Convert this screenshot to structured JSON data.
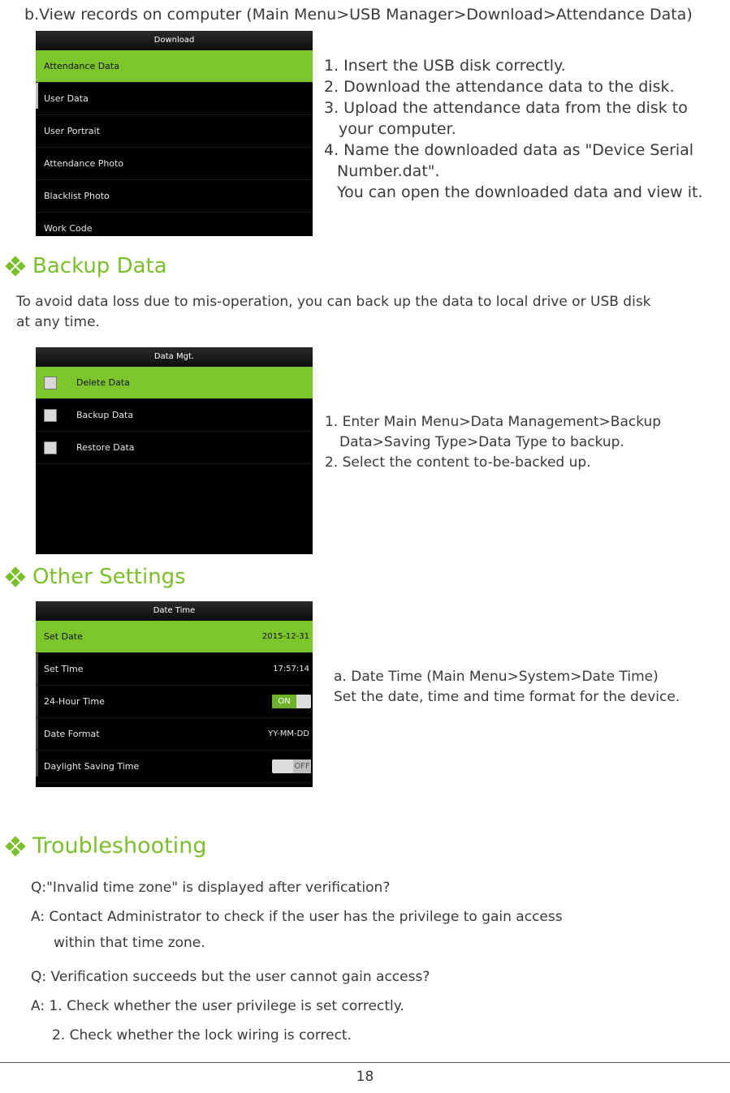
{
  "intro": "b.View records on computer (Main Menu>USB Manager>Download>Attendance Data)",
  "download_screen": {
    "title": "Download",
    "items": [
      "Attendance Data",
      "User Data",
      "User Portrait",
      "Attendance Photo",
      "Blacklist Photo",
      "Work Code"
    ]
  },
  "download_steps": [
    "1. Insert the USB disk correctly.",
    "2. Download the attendance data to the disk.",
    "3. Upload the attendance data from the disk to",
    "your computer.",
    "4. Name the downloaded data as \"Device Serial",
    "Number.dat\".",
    "You can open the downloaded data and view it."
  ],
  "backup": {
    "heading": "Backup Data",
    "intro_line1": "To avoid data loss due to mis-operation, you can back up the data to local drive or USB disk",
    "intro_line2": "at any time.",
    "screen": {
      "title": "Data Mgt.",
      "items": [
        "Delete Data",
        "Backup Data",
        "Restore Data"
      ]
    },
    "steps": [
      "1. Enter Main Menu>Data Management>Backup",
      "Data>Saving Type>Data Type to backup.",
      "2. Select the content to-be-backed up."
    ]
  },
  "other": {
    "heading": "Other Settings",
    "screen": {
      "title": "Date Time",
      "rows": [
        {
          "label": "Set Date",
          "value": "2015-12-31"
        },
        {
          "label": "Set Time",
          "value": "17:57:14"
        },
        {
          "label": "24-Hour Time",
          "value": "ON"
        },
        {
          "label": "Date Format",
          "value": "YY-MM-DD"
        },
        {
          "label": "Daylight Saving Time",
          "value": "OFF"
        }
      ]
    },
    "line1": "a. Date Time (Main Menu>System>Date Time)",
    "line2": "Set the date, time and time format for the device."
  },
  "trouble": {
    "heading": "Troubleshooting",
    "q1": "Q:\"Invalid time zone\" is displayed after verification?",
    "a1_line1": "A: Contact Administrator to check if the user has the privilege to gain access",
    "a1_line2": "within that time zone.",
    "q2": "Q: Verification succeeds but the user cannot gain access?",
    "a2_line1": "A: 1. Check whether the user privilege is set correctly.",
    "a2_line2": "2. Check whether the lock wiring is correct."
  },
  "page_number": "18",
  "colors": {
    "accent": "#7bbf2c",
    "menu_selected": "#7cc52a"
  }
}
